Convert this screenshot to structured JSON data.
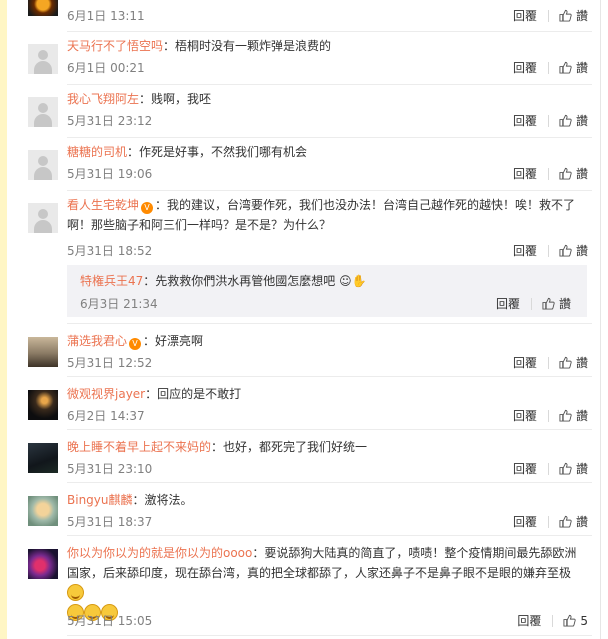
{
  "comments": [
    {
      "name": "",
      "text": "",
      "time": "6月1日 13:11",
      "reply": "回覆",
      "like": "讚"
    },
    {
      "name": "天马行不了悟空吗",
      "text": "：梧桐时没有一颗炸弹是浪费的",
      "time": "6月1日 00:21",
      "reply": "回覆",
      "like": "讚"
    },
    {
      "name": "我心飞翔阿左",
      "text": "：贱啊，我呸",
      "time": "5月31日 23:12",
      "reply": "回覆",
      "like": "讚"
    },
    {
      "name": "糖糖的司机",
      "text": "：作死是好事，不然我们哪有机会",
      "time": "5月31日 19:06",
      "reply": "回覆",
      "like": "讚"
    },
    {
      "name": "看人生宅乾坤",
      "text": "：我的建议，台湾要作死，我们也没办法！台湾自己越作死的越快！唉！救不了啊！那些脑子和阿三们一样吗？是不是？为什么？",
      "time": "5月31日 18:52",
      "reply": "回覆",
      "like": "讚"
    },
    {
      "name": "蒲选我君心",
      "text": "：好漂亮啊",
      "time": "5月31日 12:52",
      "reply": "回覆",
      "like": "讚"
    },
    {
      "name": "微观视界jayer",
      "text": "：回应的是不敢打",
      "time": "6月2日 14:37",
      "reply": "回覆",
      "like": "讚"
    },
    {
      "name": "晚上睡不着早上起不来妈的",
      "text": "：也好，都死完了我们好统一",
      "time": "5月31日 23:10",
      "reply": "回覆",
      "like": "讚"
    },
    {
      "name": "Bingyu麒麟",
      "text": "：激将法。",
      "time": "5月31日 18:37",
      "reply": "回覆",
      "like": "讚"
    },
    {
      "name": "你以为你以为的就是你以为的oooo",
      "text": "：要说舔狗大陆真的简直了，啧啧！整个疫情期间最先舔欧洲国家，后来舔印度，现在舔台湾，真的把全球都舔了，人家还鼻子不是鼻子眼不是眼的嫌弃至极",
      "time": "5月31日 15:05",
      "reply": "回覆",
      "like": "5"
    }
  ],
  "subreply": {
    "name": "特権兵王47",
    "text": "：先救救你們洪水再管他國怎麼想吧",
    "time": "6月3日 21:34",
    "reply": "回覆",
    "like": "讚"
  },
  "colors": {
    "name": "#eb7350",
    "time": "#808080",
    "subreply_bg": "#f2f2f5"
  }
}
